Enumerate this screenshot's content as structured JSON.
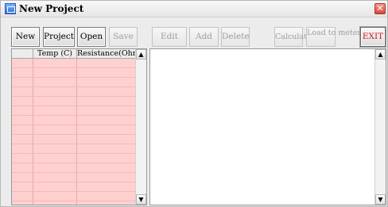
{
  "window": {
    "title": "New Project",
    "close_glyph": "✕"
  },
  "toolbar": {
    "new_label": "New",
    "project_label": "Project",
    "open_label": "Open",
    "save_label": "Save",
    "edit_label": "Edit",
    "add_label": "Add",
    "delete_label": "Delete",
    "calculate_label": "Calculate",
    "load_to_meter_label": "Load to meter",
    "exit_label": "EXIT"
  },
  "table": {
    "columns": [
      "",
      "Temp (C)",
      "Resistance(Ohm)"
    ]
  },
  "icons": {
    "app": "app-window-icon",
    "close": "close-icon",
    "scroll_up": "chevron-up-icon",
    "scroll_down": "chevron-down-icon"
  },
  "colors": {
    "grid_background": "#ffd0d0",
    "exit_text": "#d01616",
    "close_button": "#d44a3a"
  }
}
